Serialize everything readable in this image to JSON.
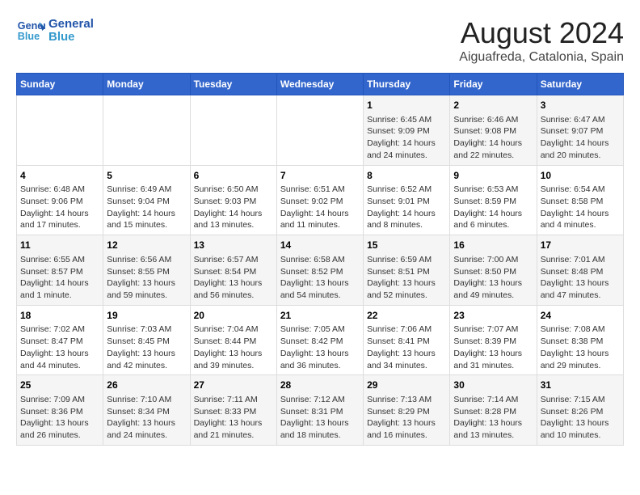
{
  "logo": {
    "line1": "General",
    "line2": "Blue"
  },
  "title": "August 2024",
  "subtitle": "Aiguafreda, Catalonia, Spain",
  "days_of_week": [
    "Sunday",
    "Monday",
    "Tuesday",
    "Wednesday",
    "Thursday",
    "Friday",
    "Saturday"
  ],
  "weeks": [
    [
      {
        "day": "",
        "info": ""
      },
      {
        "day": "",
        "info": ""
      },
      {
        "day": "",
        "info": ""
      },
      {
        "day": "",
        "info": ""
      },
      {
        "day": "1",
        "info": "Sunrise: 6:45 AM\nSunset: 9:09 PM\nDaylight: 14 hours\nand 24 minutes."
      },
      {
        "day": "2",
        "info": "Sunrise: 6:46 AM\nSunset: 9:08 PM\nDaylight: 14 hours\nand 22 minutes."
      },
      {
        "day": "3",
        "info": "Sunrise: 6:47 AM\nSunset: 9:07 PM\nDaylight: 14 hours\nand 20 minutes."
      }
    ],
    [
      {
        "day": "4",
        "info": "Sunrise: 6:48 AM\nSunset: 9:06 PM\nDaylight: 14 hours\nand 17 minutes."
      },
      {
        "day": "5",
        "info": "Sunrise: 6:49 AM\nSunset: 9:04 PM\nDaylight: 14 hours\nand 15 minutes."
      },
      {
        "day": "6",
        "info": "Sunrise: 6:50 AM\nSunset: 9:03 PM\nDaylight: 14 hours\nand 13 minutes."
      },
      {
        "day": "7",
        "info": "Sunrise: 6:51 AM\nSunset: 9:02 PM\nDaylight: 14 hours\nand 11 minutes."
      },
      {
        "day": "8",
        "info": "Sunrise: 6:52 AM\nSunset: 9:01 PM\nDaylight: 14 hours\nand 8 minutes."
      },
      {
        "day": "9",
        "info": "Sunrise: 6:53 AM\nSunset: 8:59 PM\nDaylight: 14 hours\nand 6 minutes."
      },
      {
        "day": "10",
        "info": "Sunrise: 6:54 AM\nSunset: 8:58 PM\nDaylight: 14 hours\nand 4 minutes."
      }
    ],
    [
      {
        "day": "11",
        "info": "Sunrise: 6:55 AM\nSunset: 8:57 PM\nDaylight: 14 hours\nand 1 minute."
      },
      {
        "day": "12",
        "info": "Sunrise: 6:56 AM\nSunset: 8:55 PM\nDaylight: 13 hours\nand 59 minutes."
      },
      {
        "day": "13",
        "info": "Sunrise: 6:57 AM\nSunset: 8:54 PM\nDaylight: 13 hours\nand 56 minutes."
      },
      {
        "day": "14",
        "info": "Sunrise: 6:58 AM\nSunset: 8:52 PM\nDaylight: 13 hours\nand 54 minutes."
      },
      {
        "day": "15",
        "info": "Sunrise: 6:59 AM\nSunset: 8:51 PM\nDaylight: 13 hours\nand 52 minutes."
      },
      {
        "day": "16",
        "info": "Sunrise: 7:00 AM\nSunset: 8:50 PM\nDaylight: 13 hours\nand 49 minutes."
      },
      {
        "day": "17",
        "info": "Sunrise: 7:01 AM\nSunset: 8:48 PM\nDaylight: 13 hours\nand 47 minutes."
      }
    ],
    [
      {
        "day": "18",
        "info": "Sunrise: 7:02 AM\nSunset: 8:47 PM\nDaylight: 13 hours\nand 44 minutes."
      },
      {
        "day": "19",
        "info": "Sunrise: 7:03 AM\nSunset: 8:45 PM\nDaylight: 13 hours\nand 42 minutes."
      },
      {
        "day": "20",
        "info": "Sunrise: 7:04 AM\nSunset: 8:44 PM\nDaylight: 13 hours\nand 39 minutes."
      },
      {
        "day": "21",
        "info": "Sunrise: 7:05 AM\nSunset: 8:42 PM\nDaylight: 13 hours\nand 36 minutes."
      },
      {
        "day": "22",
        "info": "Sunrise: 7:06 AM\nSunset: 8:41 PM\nDaylight: 13 hours\nand 34 minutes."
      },
      {
        "day": "23",
        "info": "Sunrise: 7:07 AM\nSunset: 8:39 PM\nDaylight: 13 hours\nand 31 minutes."
      },
      {
        "day": "24",
        "info": "Sunrise: 7:08 AM\nSunset: 8:38 PM\nDaylight: 13 hours\nand 29 minutes."
      }
    ],
    [
      {
        "day": "25",
        "info": "Sunrise: 7:09 AM\nSunset: 8:36 PM\nDaylight: 13 hours\nand 26 minutes."
      },
      {
        "day": "26",
        "info": "Sunrise: 7:10 AM\nSunset: 8:34 PM\nDaylight: 13 hours\nand 24 minutes."
      },
      {
        "day": "27",
        "info": "Sunrise: 7:11 AM\nSunset: 8:33 PM\nDaylight: 13 hours\nand 21 minutes."
      },
      {
        "day": "28",
        "info": "Sunrise: 7:12 AM\nSunset: 8:31 PM\nDaylight: 13 hours\nand 18 minutes."
      },
      {
        "day": "29",
        "info": "Sunrise: 7:13 AM\nSunset: 8:29 PM\nDaylight: 13 hours\nand 16 minutes."
      },
      {
        "day": "30",
        "info": "Sunrise: 7:14 AM\nSunset: 8:28 PM\nDaylight: 13 hours\nand 13 minutes."
      },
      {
        "day": "31",
        "info": "Sunrise: 7:15 AM\nSunset: 8:26 PM\nDaylight: 13 hours\nand 10 minutes."
      }
    ]
  ]
}
